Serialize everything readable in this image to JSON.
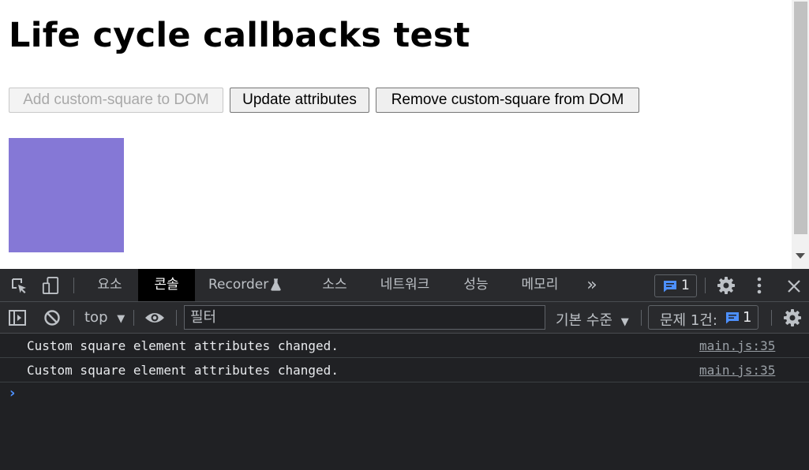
{
  "page": {
    "title": "Life cycle callbacks test",
    "buttons": {
      "add": "Add custom-square to DOM",
      "update": "Update attributes",
      "remove": "Remove custom-square from DOM"
    },
    "square_color": "#8578d6"
  },
  "devtools": {
    "tabs": [
      {
        "label": "요소"
      },
      {
        "label": "콘솔",
        "active": true
      },
      {
        "label": "Recorder"
      },
      {
        "label": "소스"
      },
      {
        "label": "네트워크"
      },
      {
        "label": "성능"
      },
      {
        "label": "메모리"
      }
    ],
    "more_tabs_glyph": "»",
    "message_count": "1",
    "toolbar": {
      "context": "top",
      "filter_placeholder": "필터",
      "level": "기본 수준",
      "issues_label": "문제 1건:",
      "issues_count": "1"
    },
    "log": [
      {
        "message": "Custom square element attributes changed.",
        "source": "main.js:35"
      },
      {
        "message": "Custom square element attributes changed.",
        "source": "main.js:35"
      }
    ],
    "prompt_glyph": "›"
  },
  "icons": {
    "inspect": "inspect-element-icon",
    "device": "device-toolbar-icon",
    "flask": "experiment-flask-icon",
    "message": "message-icon",
    "settings": "gear-icon",
    "more": "kebab-menu-icon",
    "close": "close-icon",
    "sidebar": "show-sidebar-icon",
    "clear": "clear-console-icon",
    "eye": "live-expression-eye-icon"
  }
}
